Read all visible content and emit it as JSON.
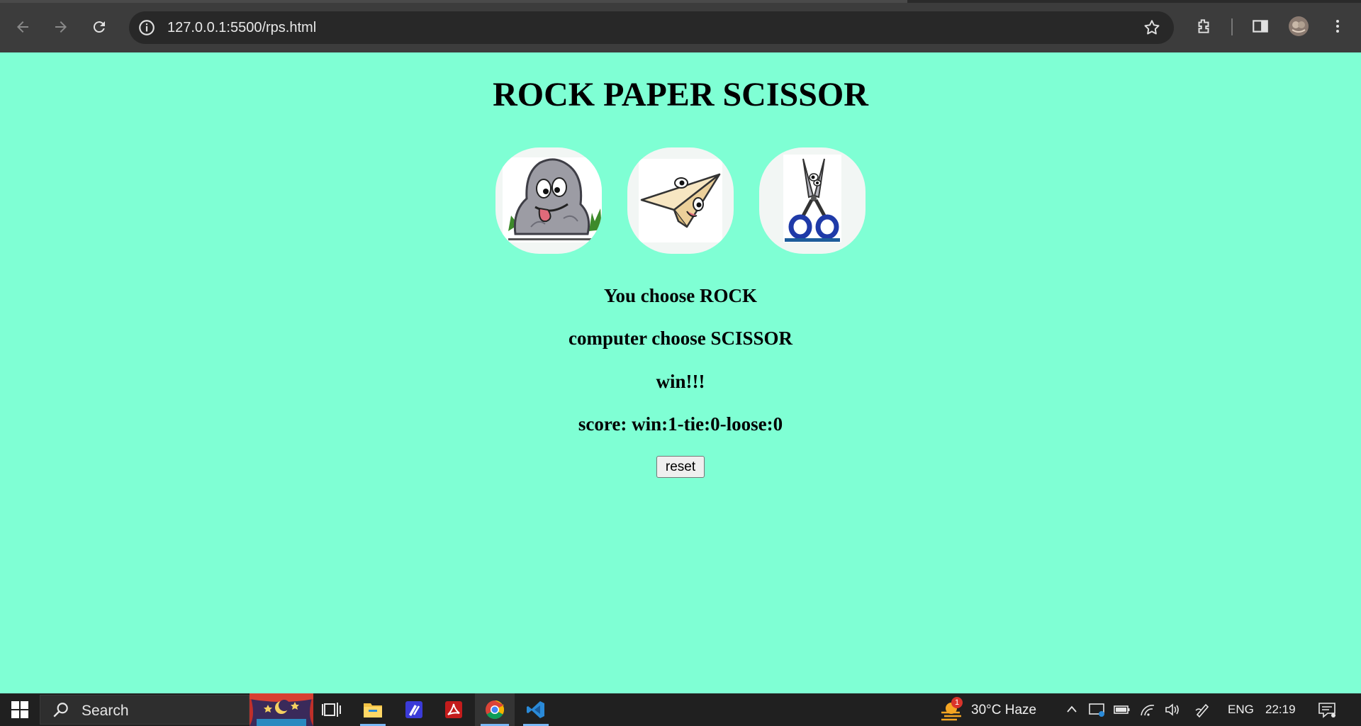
{
  "browser": {
    "url": "127.0.0.1:5500/rps.html",
    "icons": [
      "back-arrow-icon",
      "forward-arrow-icon",
      "reload-icon",
      "site-info-icon",
      "bookmark-star-icon",
      "extensions-icon",
      "side-panel-icon",
      "profile-avatar",
      "more-menu-icon"
    ]
  },
  "game": {
    "title": "ROCK PAPER SCISSOR",
    "choices": [
      "rock",
      "paper",
      "scissor"
    ],
    "user_choice_text": "You choose ROCK",
    "computer_choice_text": "computer choose SCISSOR",
    "result_text": "win!!!",
    "score_text": "score: win:1-tie:0-loose:0",
    "reset_label": "reset",
    "background_color": "#7fffd4"
  },
  "taskbar": {
    "search_label": "Search",
    "weather_badge": "1",
    "weather": "30°C  Haze",
    "language": "ENG",
    "time": "22:19",
    "apps": [
      "start-icon",
      "search-icon",
      "theater-widget-icon",
      "task-view-icon",
      "file-explorer-icon",
      "pen-app-icon",
      "acrobat-icon",
      "chrome-icon",
      "vscode-icon"
    ]
  }
}
